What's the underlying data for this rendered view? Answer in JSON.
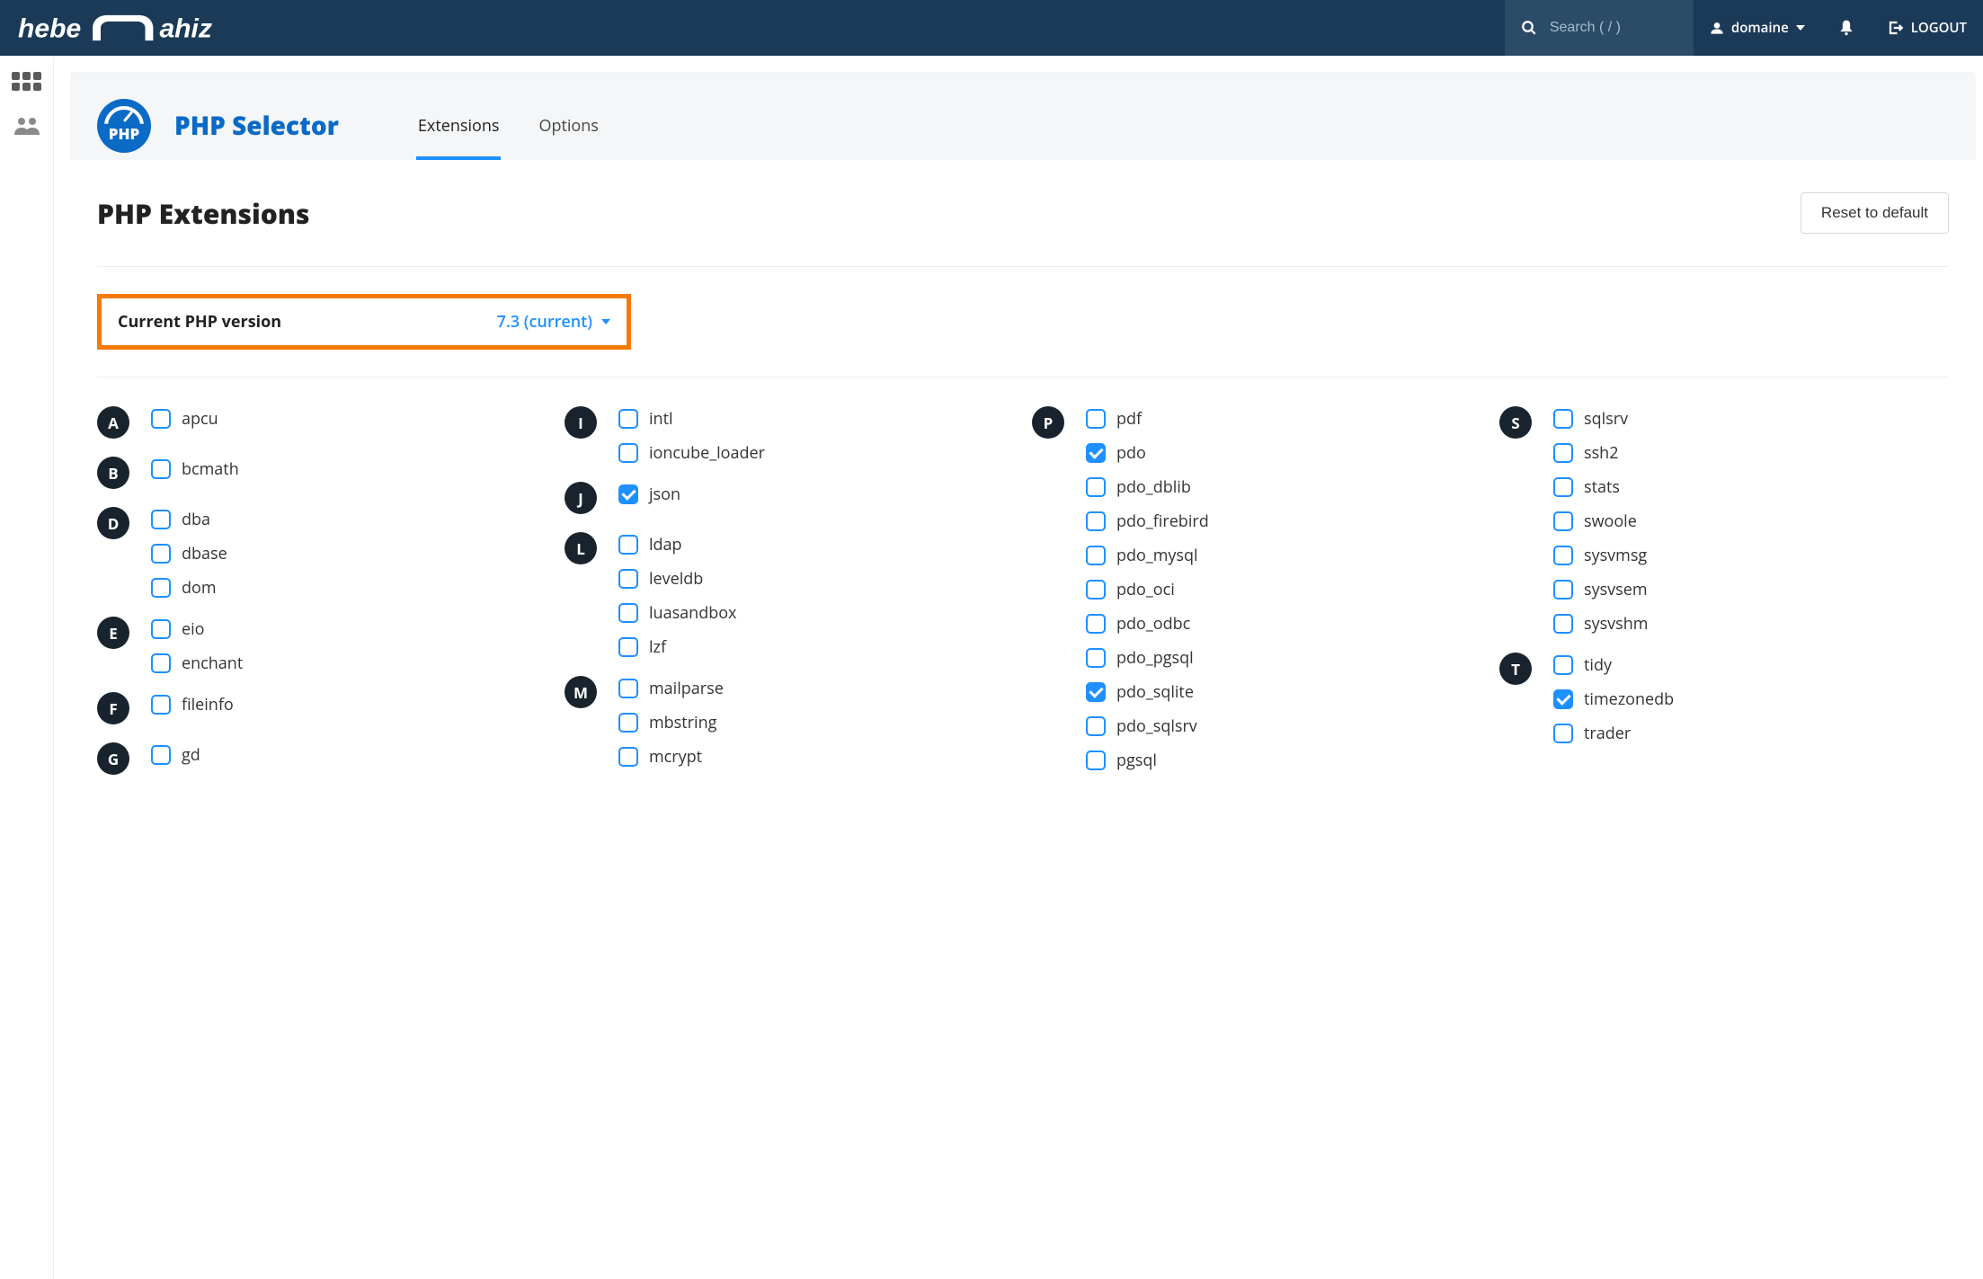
{
  "header": {
    "brand": "heberjahiz",
    "search_placeholder": "Search ( / )",
    "user_label": "domaine",
    "logout_label": "LOGOUT"
  },
  "module": {
    "icon_text": "PHP",
    "title": "PHP Selector",
    "tabs": [
      {
        "label": "Extensions",
        "active": true
      },
      {
        "label": "Options",
        "active": false
      }
    ]
  },
  "page": {
    "title": "PHP Extensions",
    "reset_label": "Reset to default"
  },
  "version": {
    "label": "Current PHP version",
    "value": "7.3 (current)"
  },
  "columns": [
    [
      {
        "letter": "A",
        "items": [
          {
            "name": "apcu",
            "checked": false
          }
        ]
      },
      {
        "letter": "B",
        "items": [
          {
            "name": "bcmath",
            "checked": false
          }
        ]
      },
      {
        "letter": "D",
        "items": [
          {
            "name": "dba",
            "checked": false
          },
          {
            "name": "dbase",
            "checked": false
          },
          {
            "name": "dom",
            "checked": false
          }
        ]
      },
      {
        "letter": "E",
        "items": [
          {
            "name": "eio",
            "checked": false
          },
          {
            "name": "enchant",
            "checked": false
          }
        ]
      },
      {
        "letter": "F",
        "items": [
          {
            "name": "fileinfo",
            "checked": false
          }
        ]
      },
      {
        "letter": "G",
        "items": [
          {
            "name": "gd",
            "checked": false
          }
        ]
      }
    ],
    [
      {
        "letter": "I",
        "items": [
          {
            "name": "intl",
            "checked": false
          },
          {
            "name": "ioncube_loader",
            "checked": false
          }
        ]
      },
      {
        "letter": "J",
        "items": [
          {
            "name": "json",
            "checked": true
          }
        ]
      },
      {
        "letter": "L",
        "items": [
          {
            "name": "ldap",
            "checked": false
          },
          {
            "name": "leveldb",
            "checked": false
          },
          {
            "name": "luasandbox",
            "checked": false
          },
          {
            "name": "lzf",
            "checked": false
          }
        ]
      },
      {
        "letter": "M",
        "items": [
          {
            "name": "mailparse",
            "checked": false
          },
          {
            "name": "mbstring",
            "checked": false
          },
          {
            "name": "mcrypt",
            "checked": false
          }
        ]
      }
    ],
    [
      {
        "letter": "P",
        "items": [
          {
            "name": "pdf",
            "checked": false
          },
          {
            "name": "pdo",
            "checked": true
          },
          {
            "name": "pdo_dblib",
            "checked": false
          },
          {
            "name": "pdo_firebird",
            "checked": false
          },
          {
            "name": "pdo_mysql",
            "checked": false
          },
          {
            "name": "pdo_oci",
            "checked": false
          },
          {
            "name": "pdo_odbc",
            "checked": false
          },
          {
            "name": "pdo_pgsql",
            "checked": false
          },
          {
            "name": "pdo_sqlite",
            "checked": true
          },
          {
            "name": "pdo_sqlsrv",
            "checked": false
          },
          {
            "name": "pgsql",
            "checked": false
          }
        ]
      }
    ],
    [
      {
        "letter": "S",
        "items": [
          {
            "name": "sqlsrv",
            "checked": false
          },
          {
            "name": "ssh2",
            "checked": false
          },
          {
            "name": "stats",
            "checked": false
          },
          {
            "name": "swoole",
            "checked": false
          },
          {
            "name": "sysvmsg",
            "checked": false
          },
          {
            "name": "sysvsem",
            "checked": false
          },
          {
            "name": "sysvshm",
            "checked": false
          }
        ]
      },
      {
        "letter": "T",
        "items": [
          {
            "name": "tidy",
            "checked": false
          },
          {
            "name": "timezonedb",
            "checked": true
          },
          {
            "name": "trader",
            "checked": false
          }
        ]
      }
    ]
  ]
}
